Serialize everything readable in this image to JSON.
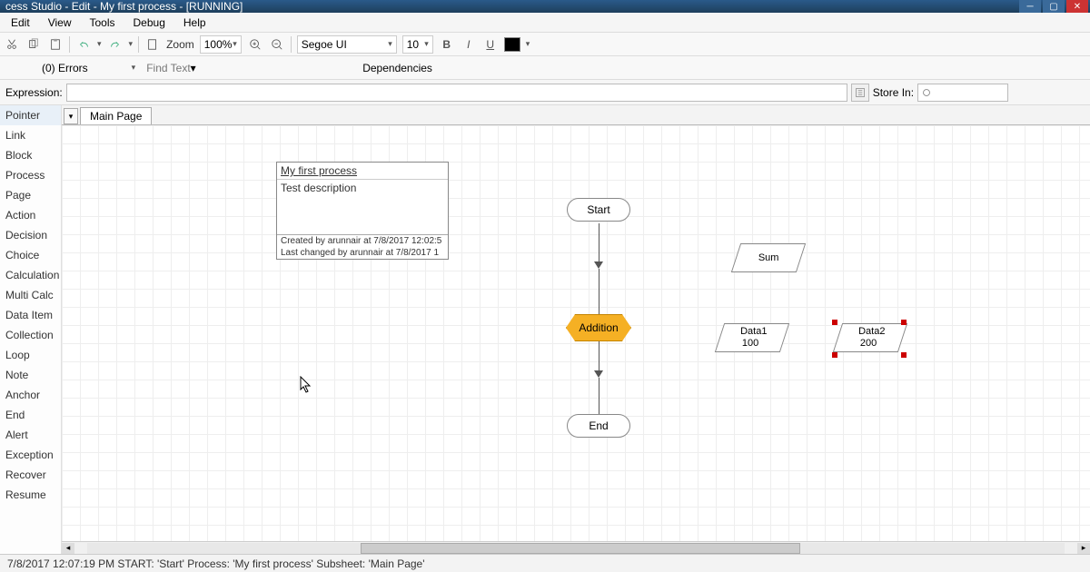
{
  "window": {
    "title": "cess Studio - Edit - My first process - [RUNNING]"
  },
  "menu": {
    "edit": "Edit",
    "view": "View",
    "tools": "Tools",
    "debug": "Debug",
    "help": "Help"
  },
  "toolbar1": {
    "zoom_label": "Zoom",
    "zoom_value": "100%",
    "font_name": "Segoe UI",
    "font_size": "10",
    "font_color": "#000000"
  },
  "toolbar2": {
    "errors": "(0) Errors",
    "find_placeholder": "Find Text",
    "dependencies": "Dependencies"
  },
  "expression": {
    "label": "Expression:",
    "value": "",
    "store_in_label": "Store In:",
    "store_in_value": ""
  },
  "sidebar_tools": [
    "Pointer",
    "Link",
    "Block",
    "Process",
    "Page",
    "Action",
    "Decision",
    "Choice",
    "Calculation",
    "Multi Calc",
    "Data Item",
    "Collection",
    "Loop",
    "Note",
    "Anchor",
    "End",
    "Alert",
    "Exception",
    "Recover",
    "Resume"
  ],
  "page_tab": "Main Page",
  "infobox": {
    "title": "My first process",
    "description": "Test description",
    "created": "Created by arunnair at 7/8/2017 12:02:5",
    "changed": "Last changed by arunnair at 7/8/2017 1"
  },
  "flow": {
    "start": "Start",
    "addition": "Addition",
    "end": "End",
    "sum": "Sum",
    "data1_name": "Data1",
    "data1_value": "100",
    "data2_name": "Data2",
    "data2_value": "200"
  },
  "status": "7/8/2017 12:07:19 PM START: 'Start' Process: 'My first process' Subsheet: 'Main Page'"
}
